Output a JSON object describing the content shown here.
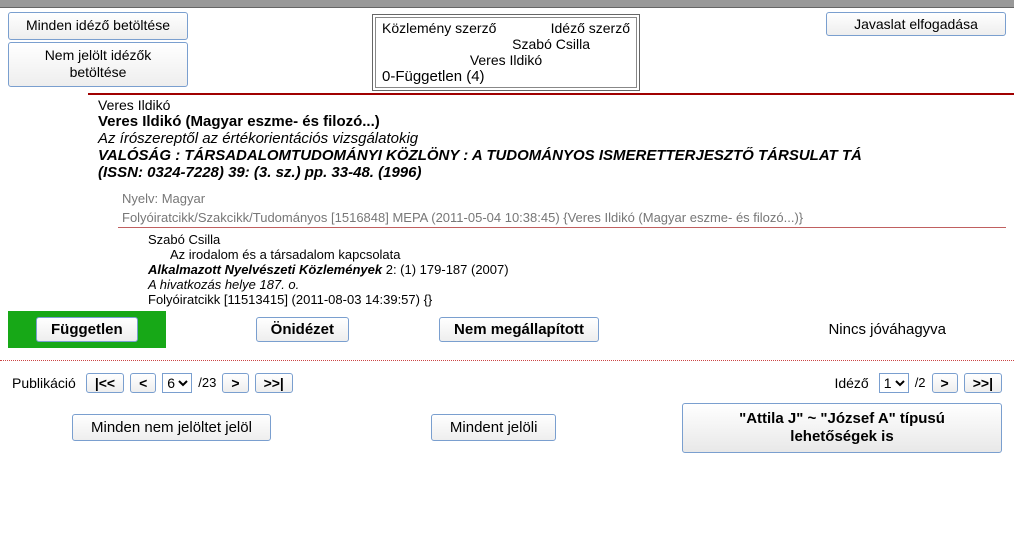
{
  "buttons": {
    "load_all_citers": "Minden idéző betöltése",
    "load_unmarked": "Nem jelölt idézők betöltése",
    "accept_suggestion": "Javaslat elfogadása",
    "independent": "Független",
    "self_cite": "Önidézet",
    "not_determined": "Nem megállapított",
    "mark_all_unmarked": "Minden nem jelöltet jelöl",
    "mark_all": "Mindent jelöli",
    "tilde_options": "\"Attila J\" ~ \"József A\" típusú lehetőségek is",
    "first": "|<<",
    "prev": "<",
    "next": ">",
    "last": ">>|"
  },
  "center": {
    "col1": "Közlemény szerző",
    "col2": "Idéző szerző",
    "name1": "Szabó Csilla",
    "name2": "Veres Ildikó",
    "footer": "0-Független (4)"
  },
  "publication": {
    "author": "Veres Ildikó",
    "title": "Veres Ildikó (Magyar eszme- és filozó...)",
    "subtitle": "Az írószereptől az értékorientációs vizsgálatokig",
    "journal": "VALÓSÁG : TÁRSADALOMTUDOMÁNYI KÖZLÖNY : A TUDOMÁNYOS ISMERETTERJESZTŐ TÁRSULAT TÁ",
    "issn_line": "(ISSN: 0324-7228) 39: (3. sz.) pp. 33-48.  (1996)",
    "language": "Nyelv: Magyar",
    "meta": "Folyóiratcikk/Szakcikk/Tudományos [1516848] MEPA (2011-05-04 10:38:45) {Veres Ildikó (Magyar eszme- és filozó...)}"
  },
  "citation": {
    "author": "Szabó Csilla",
    "title": "Az irodalom és a társadalom kapcsolata",
    "journal_strong": "Alkalmazott Nyelvészeti Közlemények",
    "journal_rest": " 2: (1) 179-187  (2007)",
    "ref_loc": "A hivatkozás helye 187. o.",
    "meta": "Folyóiratcikk [11513415] (2011-08-03 14:39:57) {}"
  },
  "status": "Nincs jóváhagyva",
  "pager": {
    "pub_label": "Publikáció",
    "pub_current": "6",
    "pub_total": "/23",
    "citer_label": "Idéző",
    "citer_current": "1",
    "citer_total": "/2"
  }
}
